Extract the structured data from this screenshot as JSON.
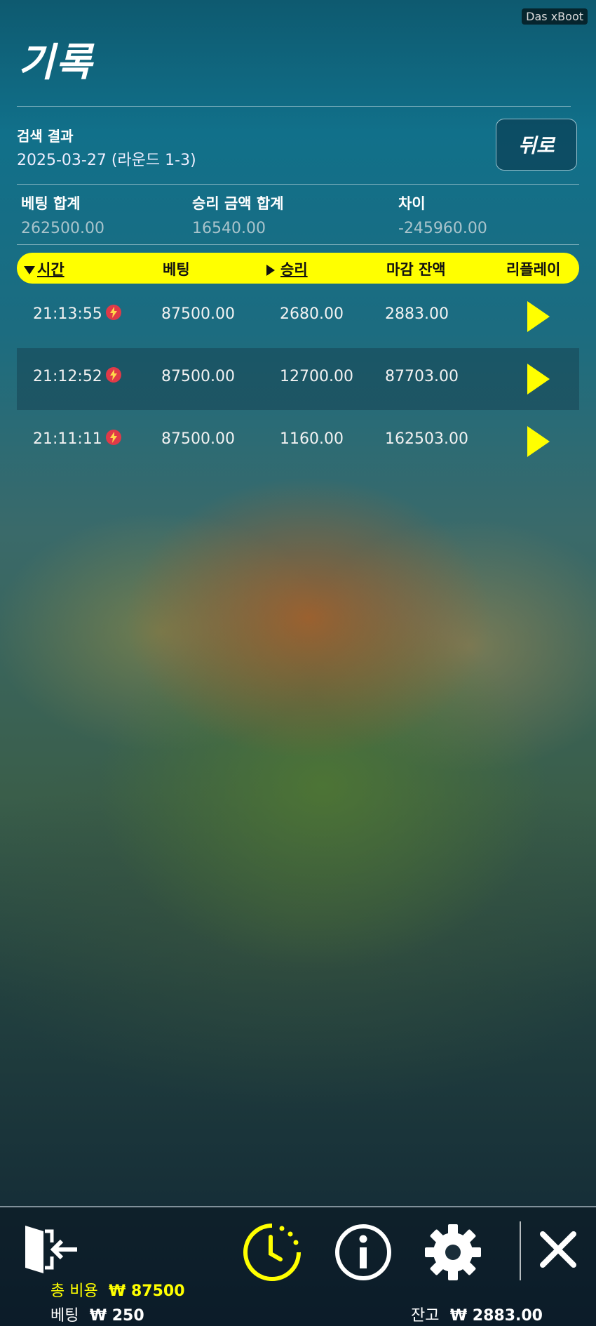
{
  "badge": "Das xBoot",
  "page": {
    "title": "기록",
    "search_label": "검색 결과",
    "search_value": "2025-03-27 (라운드 1-3)",
    "back_label": "뒤로"
  },
  "summary": {
    "bet_total_label": "베팅 합계",
    "bet_total_value": "262500.00",
    "win_total_label": "승리 금액 합계",
    "win_total_value": "16540.00",
    "diff_label": "차이",
    "diff_value": "-245960.00"
  },
  "table": {
    "headers": {
      "time": "시간",
      "bet": "베팅",
      "win": "승리",
      "balance": "마감 잔액",
      "replay": "리플레이"
    },
    "rows": [
      {
        "time": "21:13:55",
        "bet": "87500.00",
        "win": "2680.00",
        "balance": "2883.00"
      },
      {
        "time": "21:12:52",
        "bet": "87500.00",
        "win": "12700.00",
        "balance": "87703.00"
      },
      {
        "time": "21:11:11",
        "bet": "87500.00",
        "win": "1160.00",
        "balance": "162503.00"
      }
    ]
  },
  "footer": {
    "cost_label": "총 비용",
    "cost_value": "₩ 87500",
    "bet_label": "베팅",
    "bet_value": "₩ 250",
    "balance_label": "잔고",
    "balance_value": "₩ 2883.00"
  },
  "icons": {
    "exit": "exit-door-icon",
    "history": "history-clock-icon",
    "info": "info-icon",
    "settings": "gear-icon",
    "close": "close-icon",
    "replay": "play-icon",
    "bolt": "lightning-icon"
  },
  "colors": {
    "accent": "#ffff00",
    "bolt_badge": "#e03a48"
  }
}
